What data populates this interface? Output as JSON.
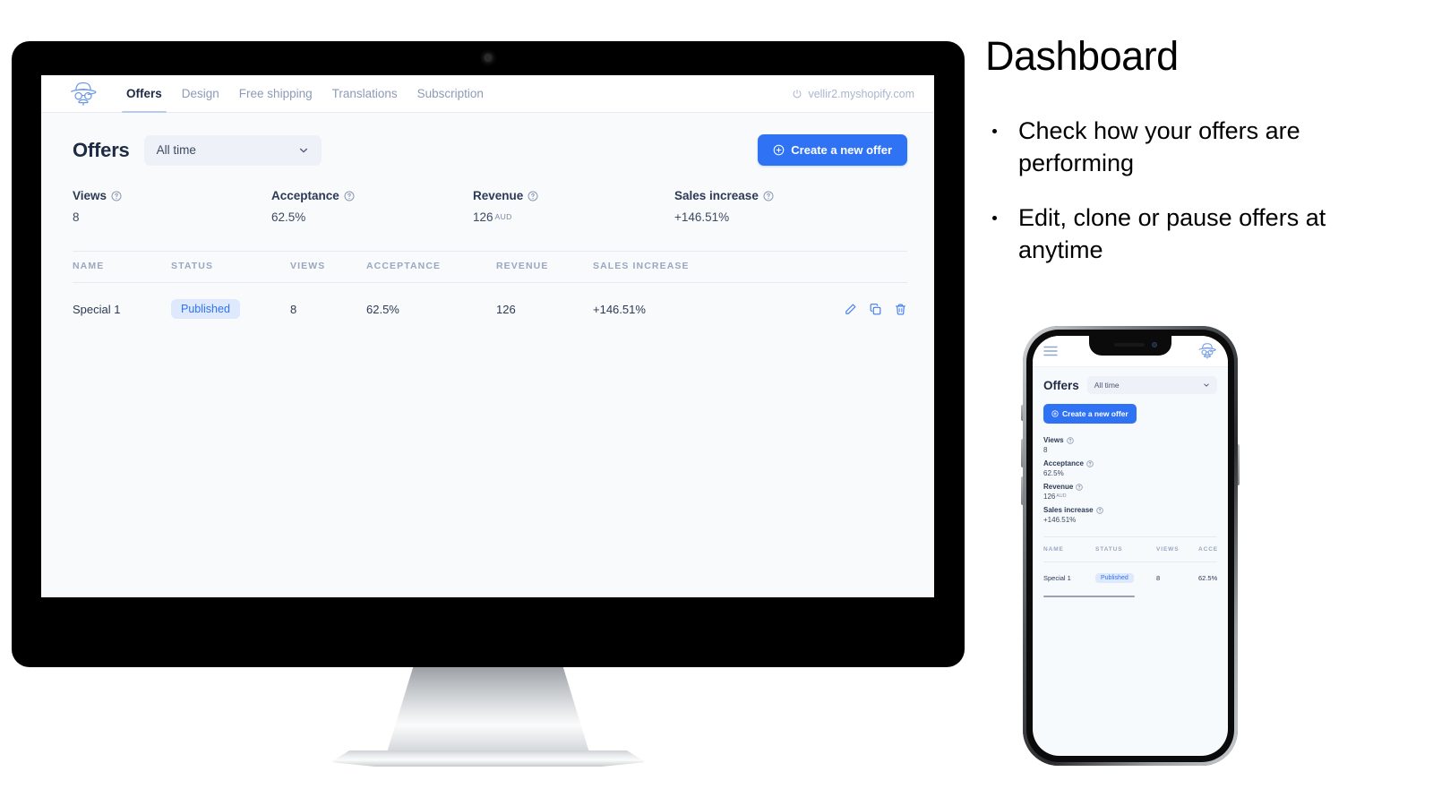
{
  "panel": {
    "heading": "Dashboard",
    "bullets": [
      "Check how your offers are performing",
      "Edit, clone or pause offers at anytime"
    ]
  },
  "app": {
    "logo_icon": "incognito-logo-icon",
    "nav": [
      {
        "label": "Offers",
        "active": true
      },
      {
        "label": "Design",
        "active": false
      },
      {
        "label": "Free shipping",
        "active": false
      },
      {
        "label": "Translations",
        "active": false
      },
      {
        "label": "Subscription",
        "active": false
      }
    ],
    "store": {
      "icon": "power-icon",
      "domain": "vellir2.myshopify.com"
    },
    "page_title": "Offers",
    "range_select": {
      "value": "All time",
      "icon": "chevron-down-icon"
    },
    "create_button": {
      "label": "Create a new offer",
      "icon": "plus-circle-icon"
    },
    "stats": [
      {
        "label": "Views",
        "value": "8",
        "currency": "",
        "help_icon": "help-circle-icon"
      },
      {
        "label": "Acceptance",
        "value": "62.5%",
        "currency": "",
        "help_icon": "help-circle-icon"
      },
      {
        "label": "Revenue",
        "value": "126",
        "currency": "AUD",
        "help_icon": "help-circle-icon"
      },
      {
        "label": "Sales increase",
        "value": "+146.51%",
        "currency": "",
        "help_icon": "help-circle-icon"
      }
    ],
    "table": {
      "columns": [
        "NAME",
        "STATUS",
        "VIEWS",
        "ACCEPTANCE",
        "REVENUE",
        "SALES INCREASE"
      ],
      "rows": [
        {
          "name": "Special 1",
          "status": "Published",
          "views": "8",
          "acceptance": "62.5%",
          "revenue": "126",
          "sales_increase": "+146.51%",
          "actions": [
            "edit-pencil-icon",
            "clone-copy-icon",
            "delete-trash-icon"
          ]
        }
      ]
    }
  },
  "phone": {
    "menu_icon": "hamburger-menu-icon",
    "logo_icon": "incognito-logo-icon",
    "page_title": "Offers",
    "range_select": {
      "value": "All time",
      "icon": "chevron-down-icon"
    },
    "create_button": {
      "label": "Create a new offer",
      "icon": "plus-circle-icon"
    },
    "stats": [
      {
        "label": "Views",
        "value": "8",
        "currency": ""
      },
      {
        "label": "Acceptance",
        "value": "62.5%",
        "currency": ""
      },
      {
        "label": "Revenue",
        "value": "126",
        "currency": "AUD"
      },
      {
        "label": "Sales increase",
        "value": "+146.51%",
        "currency": ""
      }
    ],
    "table": {
      "columns": [
        "NAME",
        "STATUS",
        "VIEWS",
        "ACCEPTA"
      ],
      "rows": [
        {
          "name": "Special 1",
          "status": "Published",
          "views": "8",
          "acceptance": "62.5%"
        }
      ]
    }
  },
  "colors": {
    "accent_blue": "#2f73f4",
    "badge_bg": "#dee9fd",
    "text_dark": "#1f2b44",
    "muted": "#9aa7bf",
    "screen_bg": "#f8fafc"
  }
}
